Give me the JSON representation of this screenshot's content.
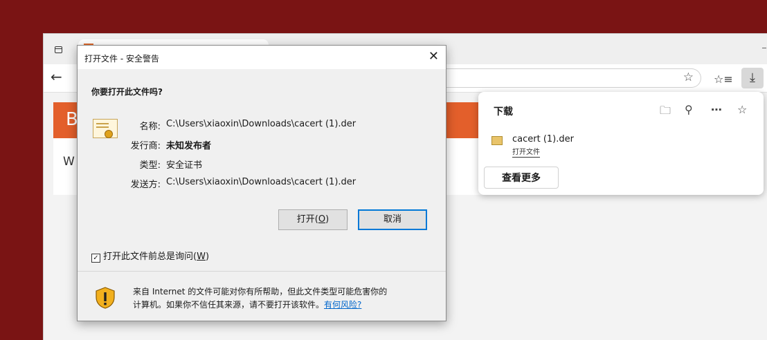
{
  "browser": {
    "card_letter": "B",
    "card_text": "W"
  },
  "downloads": {
    "title": "下载",
    "file_name": "cacert (1).der",
    "open_file": "打开文件",
    "see_more": "查看更多"
  },
  "dialog": {
    "title": "打开文件 - 安全警告",
    "question": "你要打开此文件吗?",
    "rows": [
      {
        "label": "名称:",
        "value": "C:\\Users\\xiaoxin\\Downloads\\cacert (1).der",
        "bold": false
      },
      {
        "label": "发行商:",
        "value": "未知发布者",
        "bold": true
      },
      {
        "label": "类型:",
        "value": "安全证书",
        "bold": false
      },
      {
        "label": "发送方:",
        "value": "C:\\Users\\xiaoxin\\Downloads\\cacert (1).der",
        "bold": false
      }
    ],
    "open_btn": "打开(",
    "open_key": "O",
    "open_btn_end": ")",
    "cancel_btn": "取消",
    "checkbox_label": "打开此文件前总是询问(",
    "checkbox_key": "W",
    "checkbox_end": ")",
    "checkbox_checked": true,
    "warning_line1": "来自 Internet 的文件可能对你有所帮助，但此文件类型可能危害你的",
    "warning_line2": "计算机。如果你不信任其来源，请不要打开该软件。",
    "warning_link": "有何风险?"
  }
}
